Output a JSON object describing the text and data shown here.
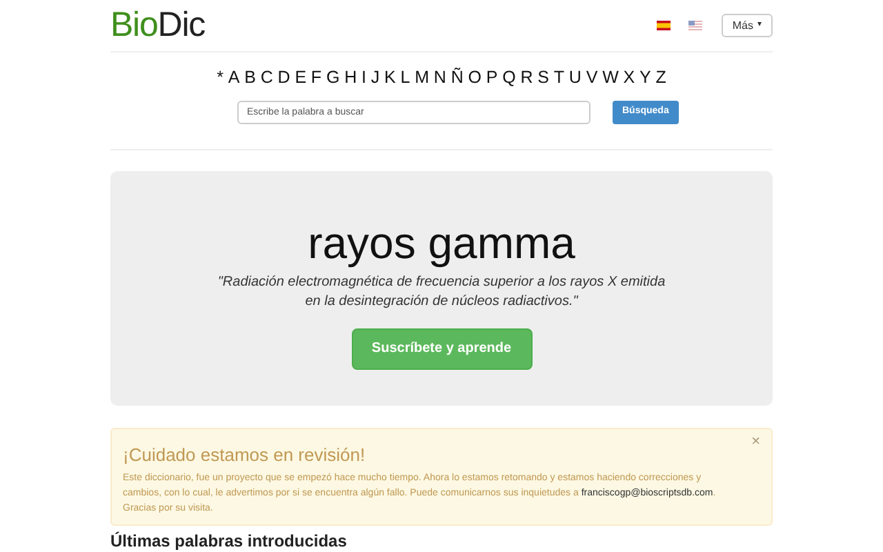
{
  "logo": {
    "part_1": "Bio",
    "part_2": "Dic"
  },
  "languages": [
    {
      "kind": "spain"
    },
    {
      "kind": "usa"
    }
  ],
  "more_menu": {
    "label": "Más",
    "caret": "▾"
  },
  "alphabet": [
    "*",
    "A",
    "B",
    "C",
    "D",
    "E",
    "F",
    "G",
    "H",
    "I",
    "J",
    "K",
    "L",
    "M",
    "N",
    "Ñ",
    "O",
    "P",
    "Q",
    "R",
    "S",
    "T",
    "U",
    "V",
    "W",
    "X",
    "Y",
    "Z"
  ],
  "search": {
    "placeholder": "Escribe la palabra a buscar",
    "button": "Búsqueda"
  },
  "hero": {
    "term": "rayos gamma",
    "definition": "\"Radiación electromagnética de frecuencia superior a los rayos X emitida en la desintegración de núcleos radiactivos.\"",
    "button": "Suscríbete y aprende"
  },
  "alert": {
    "title": "¡Cuidado estamos en revisión!",
    "close": "×",
    "text": "Este diccionario, fue un proyecto que se empezó hace mucho tiempo. Ahora lo estamos retomando y estamos haciendo correcciones y cambios, con lo cual, le advertimos por si se encuentra algún fallo. Puede comunicarnos sus inquietudes a",
    "email": "franciscogp@bioscriptsdb.com",
    "text_end": ". Gracias por su visita."
  },
  "section_heading": "Últimas palabras introducidas"
}
